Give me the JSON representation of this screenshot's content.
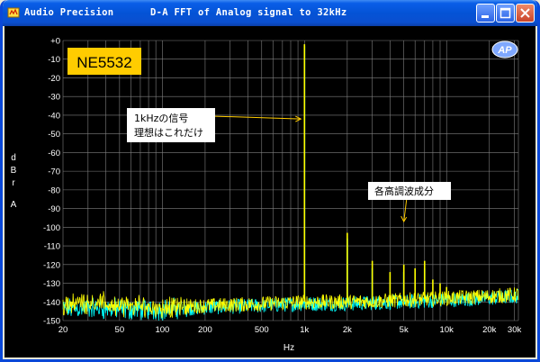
{
  "window": {
    "app_name": "Audio Precision",
    "title": "D-A FFT of Analog signal to 32kHz"
  },
  "chart_data": {
    "type": "line",
    "x_scale": "log",
    "xlim": [
      20,
      32000
    ],
    "ylim": [
      -150,
      0
    ],
    "xlabel": "Hz",
    "ylabel": [
      "d",
      "B",
      "r",
      "",
      "A"
    ],
    "grid": true,
    "x_ticks": [
      {
        "value": 20,
        "label": "20"
      },
      {
        "value": 50,
        "label": "50"
      },
      {
        "value": 100,
        "label": "100"
      },
      {
        "value": 200,
        "label": "200"
      },
      {
        "value": 500,
        "label": "500"
      },
      {
        "value": 1000,
        "label": "1k"
      },
      {
        "value": 2000,
        "label": "2k"
      },
      {
        "value": 5000,
        "label": "5k"
      },
      {
        "value": 10000,
        "label": "10k"
      },
      {
        "value": 20000,
        "label": "20k"
      },
      {
        "value": 30000,
        "label": "30k"
      }
    ],
    "y_ticks": [
      {
        "value": 0,
        "label": "+0"
      },
      {
        "value": -10,
        "label": "-10"
      },
      {
        "value": -20,
        "label": "-20"
      },
      {
        "value": -30,
        "label": "-30"
      },
      {
        "value": -40,
        "label": "-40"
      },
      {
        "value": -50,
        "label": "-50"
      },
      {
        "value": -60,
        "label": "-60"
      },
      {
        "value": -70,
        "label": "-70"
      },
      {
        "value": -80,
        "label": "-80"
      },
      {
        "value": -90,
        "label": "-90"
      },
      {
        "value": -100,
        "label": "-100"
      },
      {
        "value": -110,
        "label": "-110"
      },
      {
        "value": -120,
        "label": "-120"
      },
      {
        "value": -130,
        "label": "-130"
      },
      {
        "value": -140,
        "label": "-140"
      },
      {
        "value": -150,
        "label": "-150"
      }
    ],
    "series": [
      {
        "color": "#ffff00",
        "noise_floor": [
          [
            20,
            -141
          ],
          [
            30,
            -140
          ],
          [
            50,
            -142
          ],
          [
            100,
            -143
          ],
          [
            200,
            -142
          ],
          [
            500,
            -141
          ],
          [
            1000,
            -140
          ],
          [
            2000,
            -140
          ],
          [
            5000,
            -139
          ],
          [
            10000,
            -138
          ],
          [
            20000,
            -137
          ],
          [
            32000,
            -136
          ]
        ],
        "peaks": [
          [
            1000,
            -2
          ],
          [
            2000,
            -103
          ],
          [
            3000,
            -118
          ],
          [
            4000,
            -124
          ],
          [
            5000,
            -120
          ],
          [
            6000,
            -122
          ],
          [
            7000,
            -118
          ],
          [
            8000,
            -128
          ],
          [
            9000,
            -130
          ],
          [
            10000,
            -132
          ]
        ]
      },
      {
        "color": "#00ffff",
        "noise_floor": [
          [
            20,
            -144
          ],
          [
            30,
            -143
          ],
          [
            50,
            -144
          ],
          [
            100,
            -144
          ],
          [
            200,
            -143
          ],
          [
            500,
            -142
          ],
          [
            1000,
            -141
          ],
          [
            2000,
            -141
          ],
          [
            5000,
            -140
          ],
          [
            10000,
            -139
          ],
          [
            20000,
            -138
          ],
          [
            32000,
            -137
          ]
        ],
        "peaks": [
          [
            1000,
            -3
          ],
          [
            2000,
            -106
          ],
          [
            3000,
            -122
          ],
          [
            5000,
            -124
          ],
          [
            7000,
            -122
          ]
        ]
      }
    ],
    "annotations": [
      {
        "text": [
          "1kHzの信号",
          "理想はこれだけ"
        ],
        "arrow_to": [
          1000,
          -42
        ]
      },
      {
        "text": [
          "各高調波成分"
        ],
        "arrow_to": [
          5000,
          -97
        ]
      }
    ],
    "label_box": "NE5532",
    "logo": "AP"
  },
  "colors": {
    "accent": "#ffcc00",
    "grid": "#808080"
  }
}
